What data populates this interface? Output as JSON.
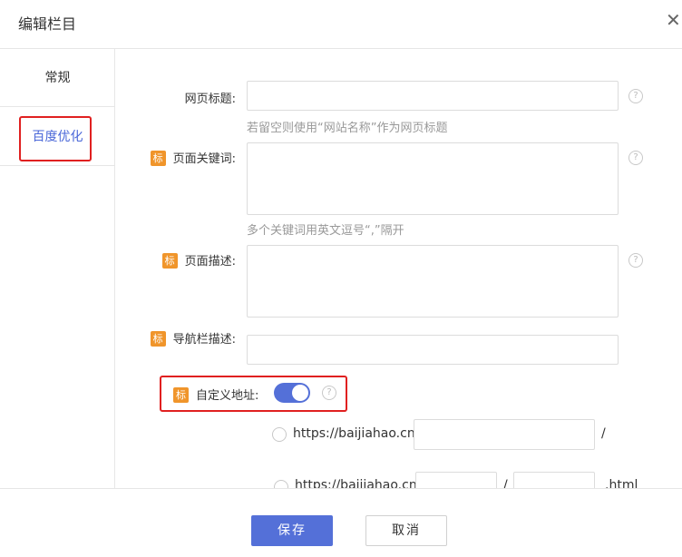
{
  "dialog": {
    "title": "编辑栏目",
    "close_icon": "close-icon"
  },
  "sidebar": {
    "items": [
      {
        "label": "常规",
        "active": false
      },
      {
        "label": "百度优化",
        "active": true
      }
    ]
  },
  "form": {
    "tag_label": "标",
    "help_glyph": "?",
    "page_title": {
      "label": "网页标题:",
      "value": "",
      "hint": "若留空则使用“网站名称”作为网页标题"
    },
    "page_keywords": {
      "label": "页面关键词:",
      "value": "",
      "hint": "多个关键词用英文逗号“,”隔开"
    },
    "page_description": {
      "label": "页面描述:",
      "value": ""
    },
    "nav_description": {
      "label": "导航栏描述:",
      "value": ""
    },
    "custom_url": {
      "label": "自定义地址:",
      "enabled": true,
      "option1": {
        "prefix": "https://baijiahao.cn/",
        "value": "",
        "suffix": "/"
      },
      "option2": {
        "prefix": "https://baijiahao.cn/",
        "value1": "",
        "separator": "/",
        "value2": "",
        "suffix": ".html"
      }
    }
  },
  "footer": {
    "save_label": "保存",
    "cancel_label": "取消"
  },
  "colors": {
    "accent": "#5470d8",
    "tag": "#f0952b",
    "highlight_border": "#e02020"
  }
}
